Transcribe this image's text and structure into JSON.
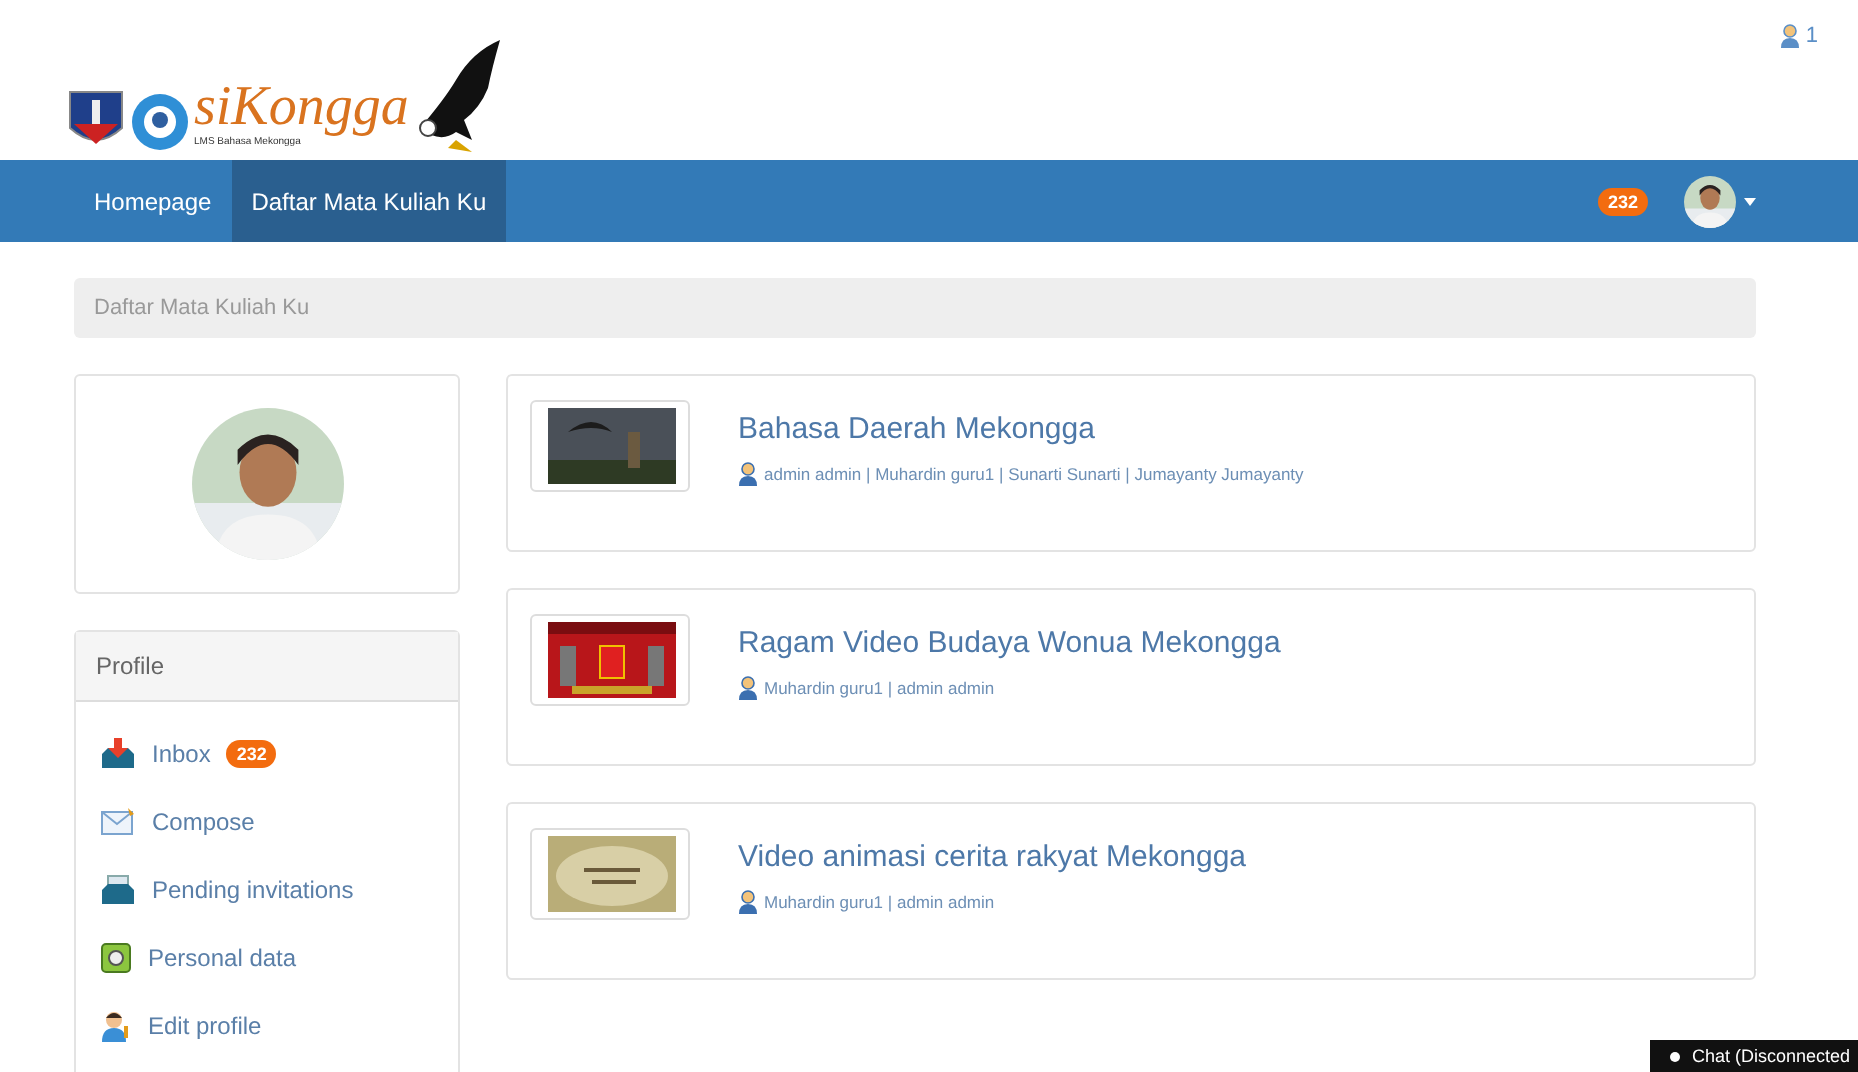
{
  "logo": {
    "title": "siKongga",
    "subtitle": "LMS Bahasa Mekongga"
  },
  "top_bar": {
    "user_count": "1"
  },
  "navbar": {
    "items": [
      {
        "label": "Homepage",
        "selected": false
      },
      {
        "label": "Daftar Mata Kuliah Ku",
        "selected": true
      }
    ],
    "badge": "232"
  },
  "breadcrumb": "Daftar Mata Kuliah Ku",
  "profile": {
    "title": "Profile",
    "items": [
      {
        "kind": "inbox",
        "label": "Inbox",
        "badge": "232"
      },
      {
        "kind": "compose",
        "label": "Compose"
      },
      {
        "kind": "invitations",
        "label": "Pending invitations"
      },
      {
        "kind": "personal",
        "label": "Personal data"
      },
      {
        "kind": "edit",
        "label": "Edit profile"
      }
    ]
  },
  "courses": [
    {
      "title": "Bahasa Daerah Mekongga",
      "teachers": "admin admin | Muhardin guru1 | Sunarti Sunarti | Jumayanty Jumayanty",
      "kind": "dark"
    },
    {
      "title": "Ragam Video Budaya Wonua Mekongga",
      "teachers": "Muhardin guru1 | admin admin",
      "kind": "red"
    },
    {
      "title": "Video animasi cerita rakyat Mekongga",
      "teachers": "Muhardin guru1 | admin admin",
      "kind": "paper"
    }
  ],
  "chat": "Chat (Disconnected"
}
